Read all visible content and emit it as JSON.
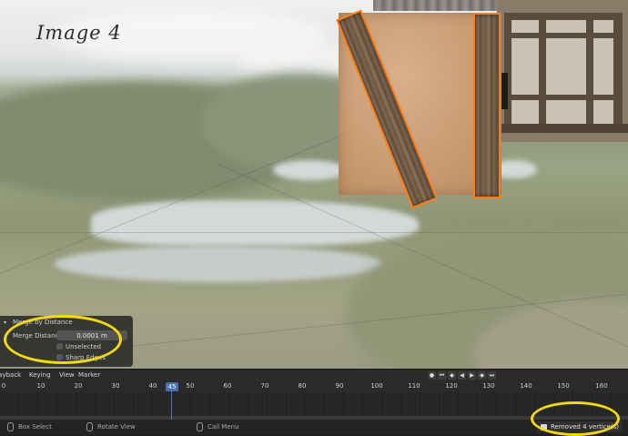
{
  "viewport": {
    "handwritten_note": "Image 4"
  },
  "operator_panel": {
    "title": "Merge by Distance",
    "merge_distance_label": "Merge Distance",
    "merge_distance_value": "0.0001 m",
    "unselected_label": "Unselected",
    "sharp_edges_label": "Sharp Edges"
  },
  "timeline": {
    "menus": [
      "Playback",
      "Keying",
      "View",
      "Marker"
    ],
    "ticks": [
      "0",
      "10",
      "20",
      "30",
      "40",
      "50",
      "60",
      "70",
      "80",
      "90",
      "100",
      "110",
      "120",
      "130",
      "140",
      "150",
      "160"
    ],
    "current_frame": "45",
    "accent": "#4772b3"
  },
  "statusbar": {
    "box_select": "Box Select",
    "rotate_view": "Rotate View",
    "call_menu": "Call Menu",
    "report": "Removed 4 vertice(s)"
  },
  "colors": {
    "selection_outline": "#ff7d1a",
    "annotation": "#f5d90f"
  }
}
